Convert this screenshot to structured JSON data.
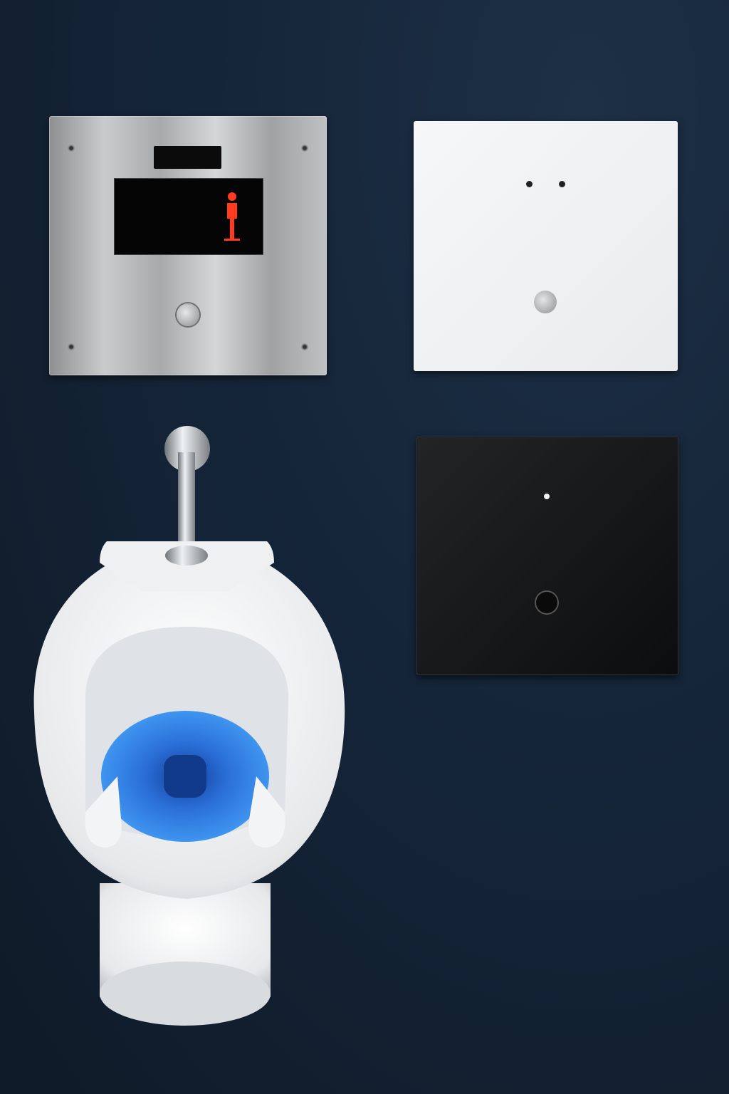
{
  "colors": {
    "background": "#152539",
    "steel_panel": "#b4b6b8",
    "sensor_figure": "#ff3b1f",
    "white_panel": "#f2f3f4",
    "black_panel": "#151617",
    "water": "#2a7de0"
  }
}
